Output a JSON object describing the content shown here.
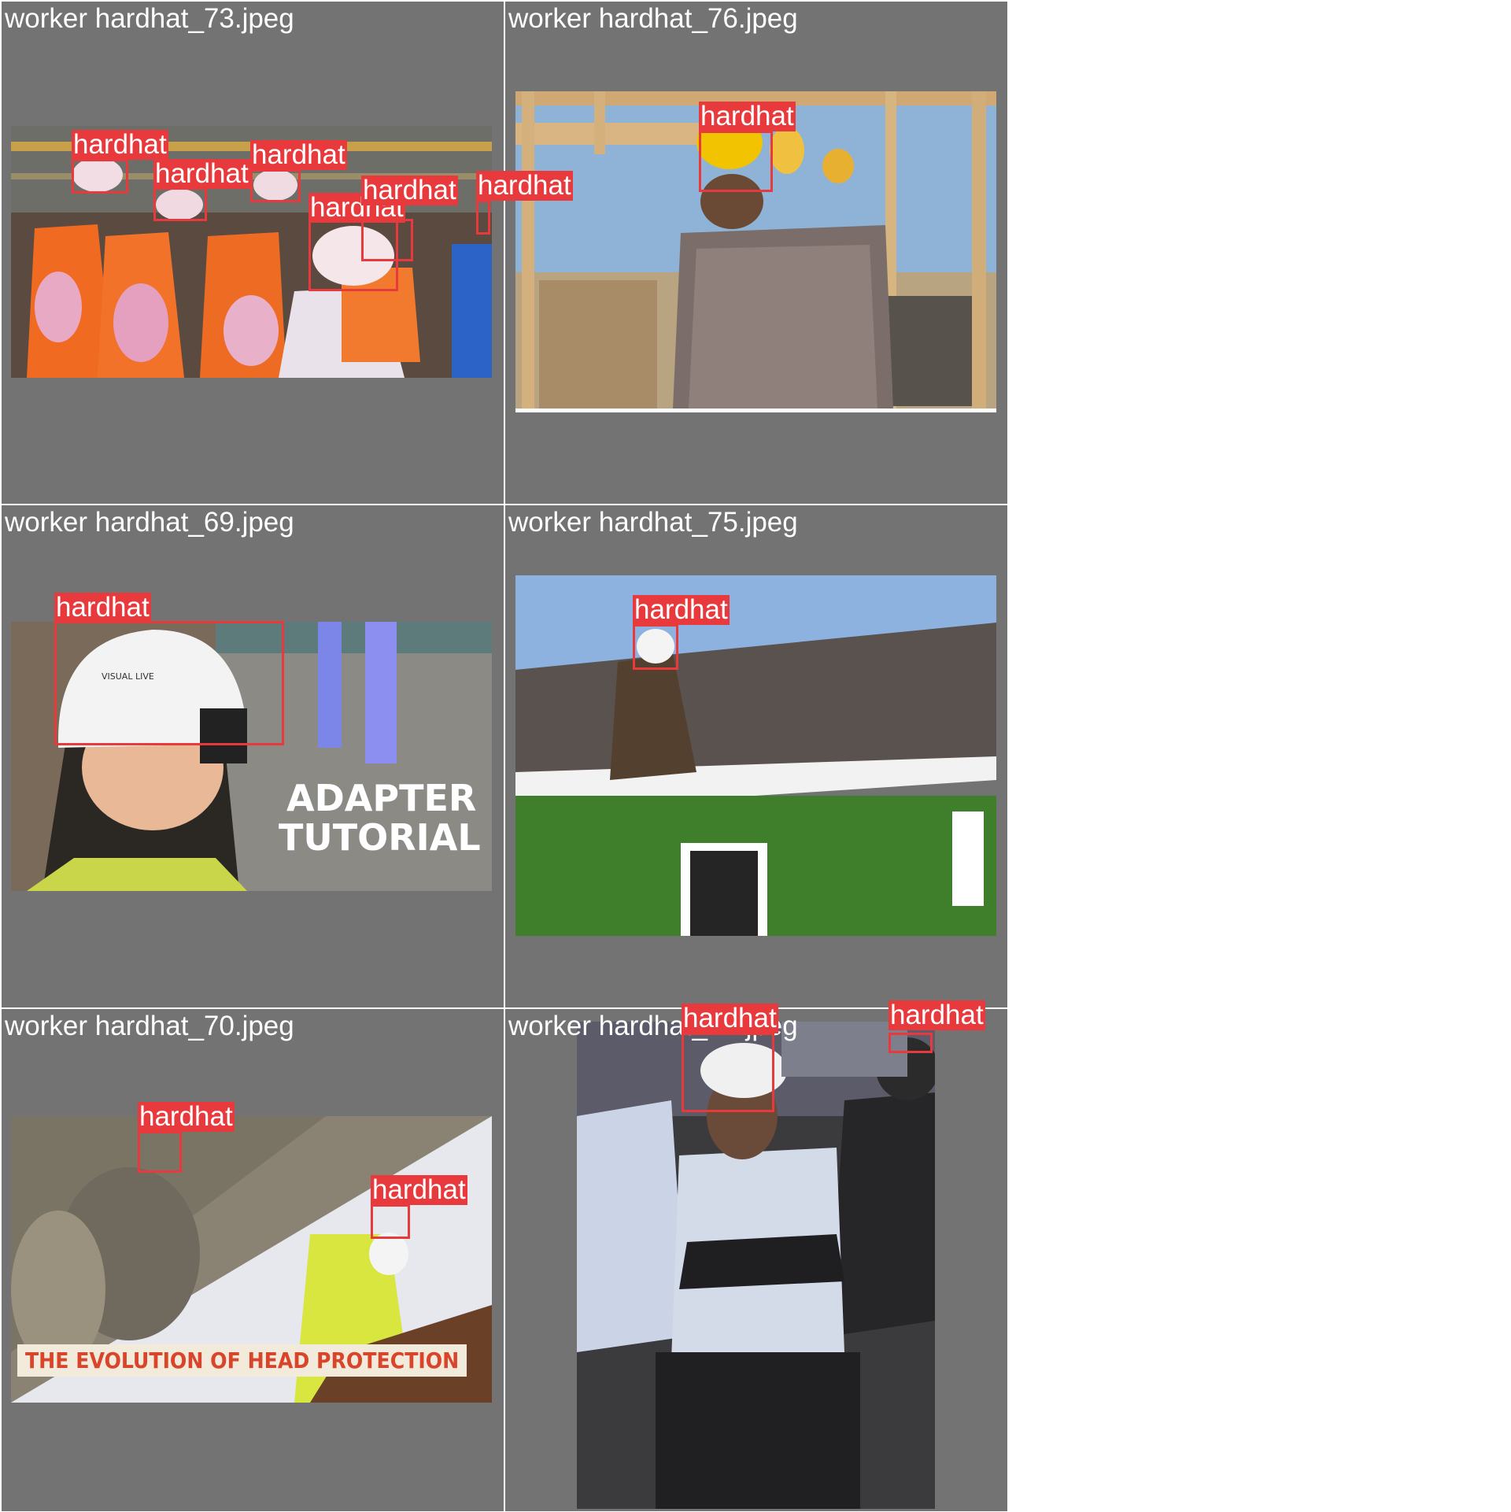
{
  "label_text": "hardhat",
  "accent_color": "#e8393c",
  "cells": [
    {
      "title": "worker hardhat_73.jpeg"
    },
    {
      "title": "worker hardhat_76.jpeg"
    },
    {
      "title": "worker hardhat_69.jpeg",
      "overlay_line1": "ADAPTER",
      "overlay_line2": "TUTORIAL",
      "helmet_brand": "VISUAL LIVE"
    },
    {
      "title": "worker hardhat_75.jpeg"
    },
    {
      "title": "worker hardhat_70.jpeg",
      "banner": "THE EVOLUTION OF HEAD PROTECTION"
    },
    {
      "title": "worker hardhat_71.jpeg"
    }
  ]
}
